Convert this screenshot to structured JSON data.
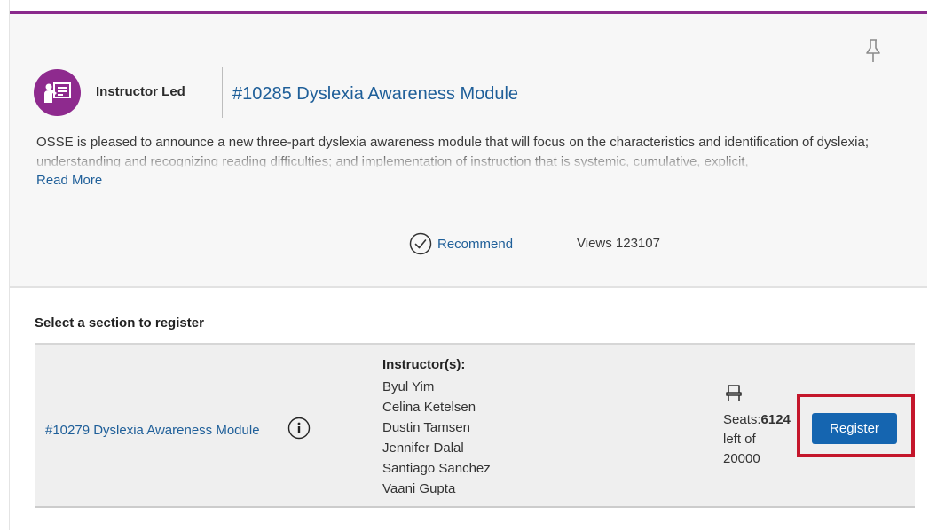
{
  "course": {
    "type_label": "Instructor Led",
    "title": "#10285 Dyslexia Awareness Module",
    "description": "OSSE is pleased to announce a new three-part dyslexia awareness module that will focus on the characteristics and identification of dyslexia; understanding and recognizing reading difficulties; and implementation of instruction that is systemic, cumulative, explicit,",
    "read_more": "Read More",
    "recommend_label": "Recommend",
    "views_text": "Views 123107",
    "icons": {
      "type": "classroom-board-icon",
      "pin": "pin-icon",
      "recommend": "check-circle-icon"
    },
    "colors": {
      "accent": "#8a2a8c",
      "link": "#1f5f99"
    }
  },
  "sections": {
    "heading": "Select a section to register",
    "items": [
      {
        "title": "#10279 Dyslexia Awareness Module",
        "instructors_label": "Instructor(s):",
        "instructors": [
          "Byul Yim",
          "Celina Ketelsen",
          "Dustin Tamsen",
          "Jennifer Dalal",
          "Santiago Sanchez",
          "Vaani Gupta"
        ],
        "seats_label": "Seats:",
        "seats_available": "6124",
        "seats_suffix": "left of",
        "seats_total": "20000",
        "register_label": "Register",
        "icons": {
          "info": "info-icon",
          "seat": "seat-icon"
        },
        "colors": {
          "button": "#1565b0",
          "highlight": "#c4162b"
        }
      }
    ]
  }
}
